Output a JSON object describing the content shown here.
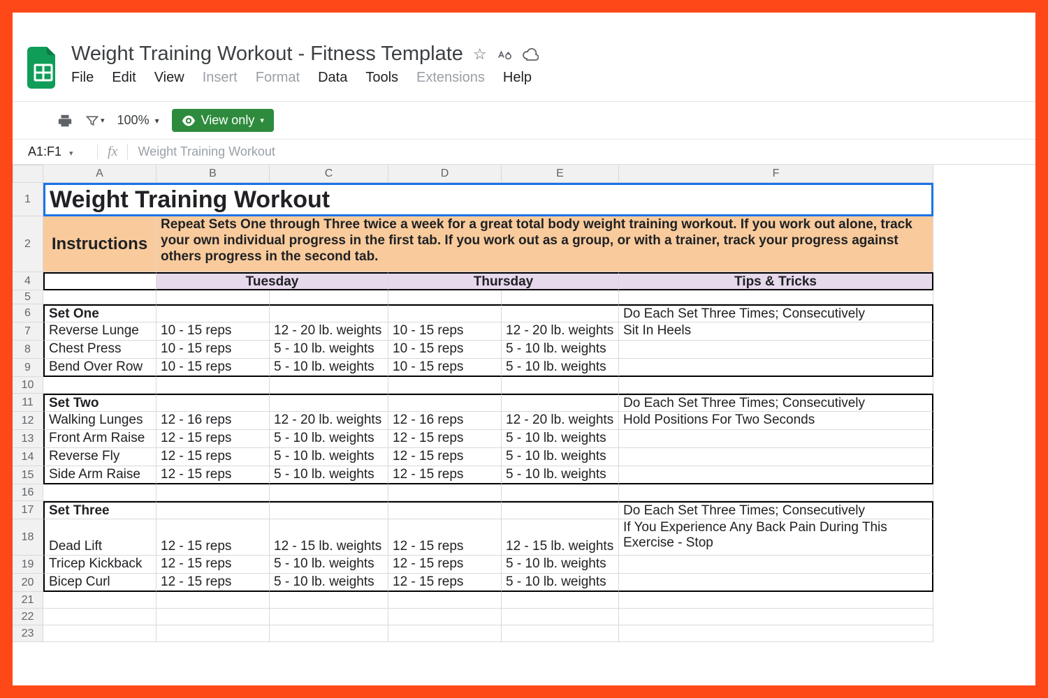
{
  "doc": {
    "title": "Weight Training Workout - Fitness Template",
    "menus": [
      "File",
      "Edit",
      "View",
      "Insert",
      "Format",
      "Data",
      "Tools",
      "Extensions",
      "Help"
    ],
    "menus_disabled": [
      3,
      4,
      7
    ],
    "zoom": "100%",
    "view_only": "View only",
    "name_box": "A1:F1",
    "fx_value": "Weight Training Workout"
  },
  "cols": [
    "A",
    "B",
    "C",
    "D",
    "E",
    "F"
  ],
  "rownums": [
    "1",
    "2",
    "4",
    "5",
    "6",
    "7",
    "8",
    "9",
    "10",
    "11",
    "12",
    "13",
    "14",
    "15",
    "16",
    "17",
    "18",
    "19",
    "20",
    "21",
    "22",
    "23"
  ],
  "title_cell": "Weight Training Workout",
  "instructions_label": "Instructions",
  "instructions_text": "Repeat Sets One through Three twice a week for a great total body weight training workout.  If you work out alone, track your own individual progress in the first tab.  If you work out as a group, or with a trainer, track your progress against others progress in the second tab.",
  "day_headers": {
    "tue": "Tuesday",
    "thu": "Thursday",
    "tips": "Tips & Tricks"
  },
  "sets": [
    {
      "name": "Set One",
      "tips": [
        "Do Each Set Three Times; Consecutively",
        "Sit In Heels"
      ],
      "rows": [
        {
          "ex": "Reverse Lunge",
          "t1": "10 - 15 reps",
          "t2": "12 - 20 lb. weights",
          "t3": "10 - 15 reps",
          "t4": "12 - 20 lb. weights"
        },
        {
          "ex": "Chest Press",
          "t1": "10 - 15 reps",
          "t2": "5 - 10 lb. weights",
          "t3": "10 - 15 reps",
          "t4": "5 - 10 lb. weights"
        },
        {
          "ex": "Bend Over Row",
          "t1": "10 - 15 reps",
          "t2": "5 - 10 lb. weights",
          "t3": "10 - 15 reps",
          "t4": "5 - 10 lb. weights"
        }
      ]
    },
    {
      "name": "Set Two",
      "tips": [
        "Do Each Set Three Times; Consecutively",
        "Hold Positions For Two Seconds"
      ],
      "rows": [
        {
          "ex": "Walking Lunges",
          "t1": "12 - 16 reps",
          "t2": "12 - 20 lb. weights",
          "t3": "12 - 16 reps",
          "t4": "12 - 20 lb. weights"
        },
        {
          "ex": "Front Arm Raise",
          "t1": "12 - 15 reps",
          "t2": "5 - 10 lb. weights",
          "t3": "12 - 15 reps",
          "t4": "5 - 10 lb. weights"
        },
        {
          "ex": "Reverse Fly",
          "t1": "12 - 15 reps",
          "t2": "5 - 10 lb. weights",
          "t3": "12 - 15 reps",
          "t4": "5 - 10 lb. weights"
        },
        {
          "ex": "Side Arm Raise",
          "t1": "12 - 15 reps",
          "t2": "5 - 10 lb. weights",
          "t3": "12 - 15 reps",
          "t4": "5 - 10 lb. weights"
        }
      ]
    },
    {
      "name": "Set Three",
      "tips": [
        "Do Each Set Three Times; Consecutively",
        "If You Experience Any Back Pain During This Exercise - Stop"
      ],
      "rows": [
        {
          "ex": "Dead Lift",
          "t1": "12 - 15 reps",
          "t2": "12 - 15 lb. weights",
          "t3": "12 - 15 reps",
          "t4": "12 - 15 lb. weights"
        },
        {
          "ex": "Tricep Kickback",
          "t1": "12 - 15 reps",
          "t2": "5 - 10 lb. weights",
          "t3": "12 - 15 reps",
          "t4": "5 - 10 lb. weights"
        },
        {
          "ex": "Bicep Curl",
          "t1": "12 - 15 reps",
          "t2": "5 - 10 lb. weights",
          "t3": "12 - 15 reps",
          "t4": "5 - 10 lb. weights"
        }
      ]
    }
  ]
}
